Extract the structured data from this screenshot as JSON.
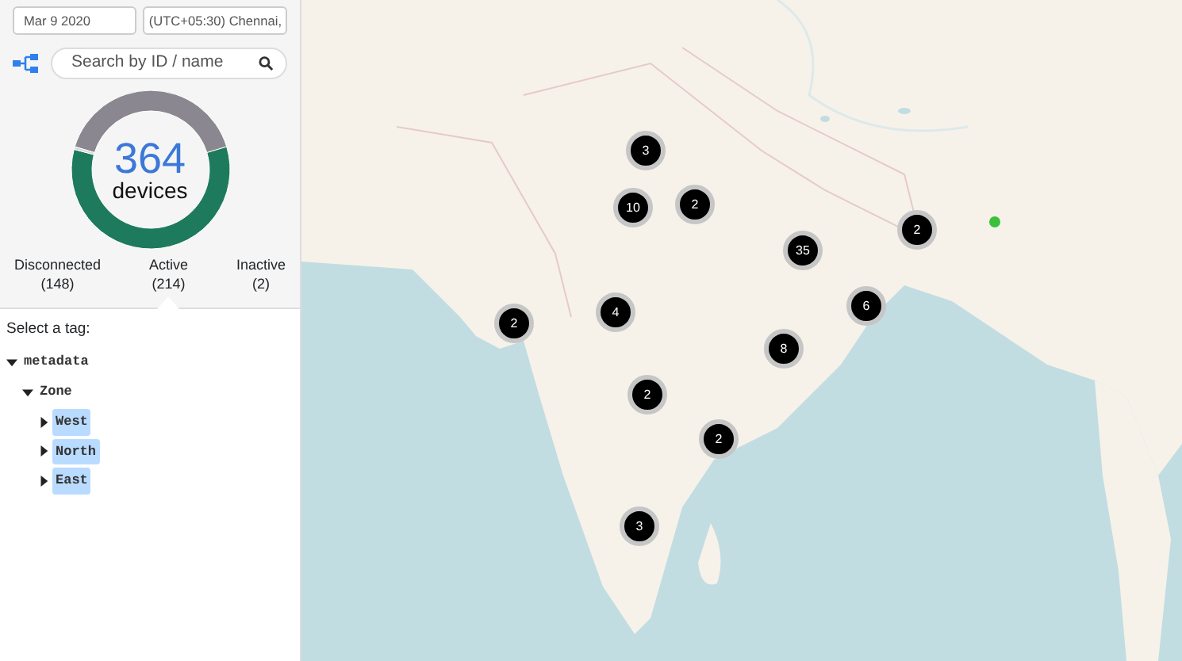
{
  "filters": {
    "date": "Mar 9 2020",
    "timezone": "(UTC+05:30) Chennai,"
  },
  "search": {
    "placeholder": "Search by ID / name"
  },
  "summary": {
    "count": "364",
    "chart_data": {
      "type": "donut",
      "categories": [
        "Disconnected",
        "Active",
        "Inactive"
      ],
      "series": [
        {
          "name": "devices",
          "values": [
            40.66,
            58.79,
            0.55
          ]
        }
      ],
      "colors": [
        "#8a8790",
        "#1e7a5c",
        "#d8d8d8"
      ]
    }
  },
  "legend": [
    {
      "count": "(148)",
      "selected": false
    },
    {
      "count": "(214)",
      "selected": true
    },
    {
      "count": "(2)",
      "selected": false
    }
  ],
  "tag_picker": {
    "prompt": "Select a tag:",
    "tree": [
      {
        "label": "metadata",
        "expanded": true,
        "selected": false,
        "children": [
          {
            "label": "Zone",
            "expanded": true,
            "selected": false,
            "children": [
              {
                "label": "West",
                "expanded": false,
                "selected": true
              },
              {
                "label": "North",
                "expanded": false,
                "selected": true
              },
              {
                "label": "East",
                "expanded": false,
                "selected": true
              }
            ]
          }
        ]
      }
    ]
  },
  "map": {
    "markers": [
      {
        "kind": "cluster",
        "count": "3"
      },
      {
        "kind": "cluster",
        "count": "2"
      },
      {
        "kind": "cluster",
        "count": "10"
      },
      {
        "kind": "cluster",
        "count": "35"
      },
      {
        "kind": "cluster",
        "count": "2"
      },
      {
        "kind": "device",
        "color": "#3cc03c"
      },
      {
        "kind": "cluster",
        "count": "2"
      },
      {
        "kind": "cluster",
        "count": "4"
      },
      {
        "kind": "cluster",
        "count": "6"
      },
      {
        "kind": "cluster",
        "count": "8"
      },
      {
        "kind": "cluster",
        "count": "2"
      },
      {
        "kind": "cluster",
        "count": "2"
      },
      {
        "kind": "cluster",
        "count": "3"
      }
    ]
  }
}
